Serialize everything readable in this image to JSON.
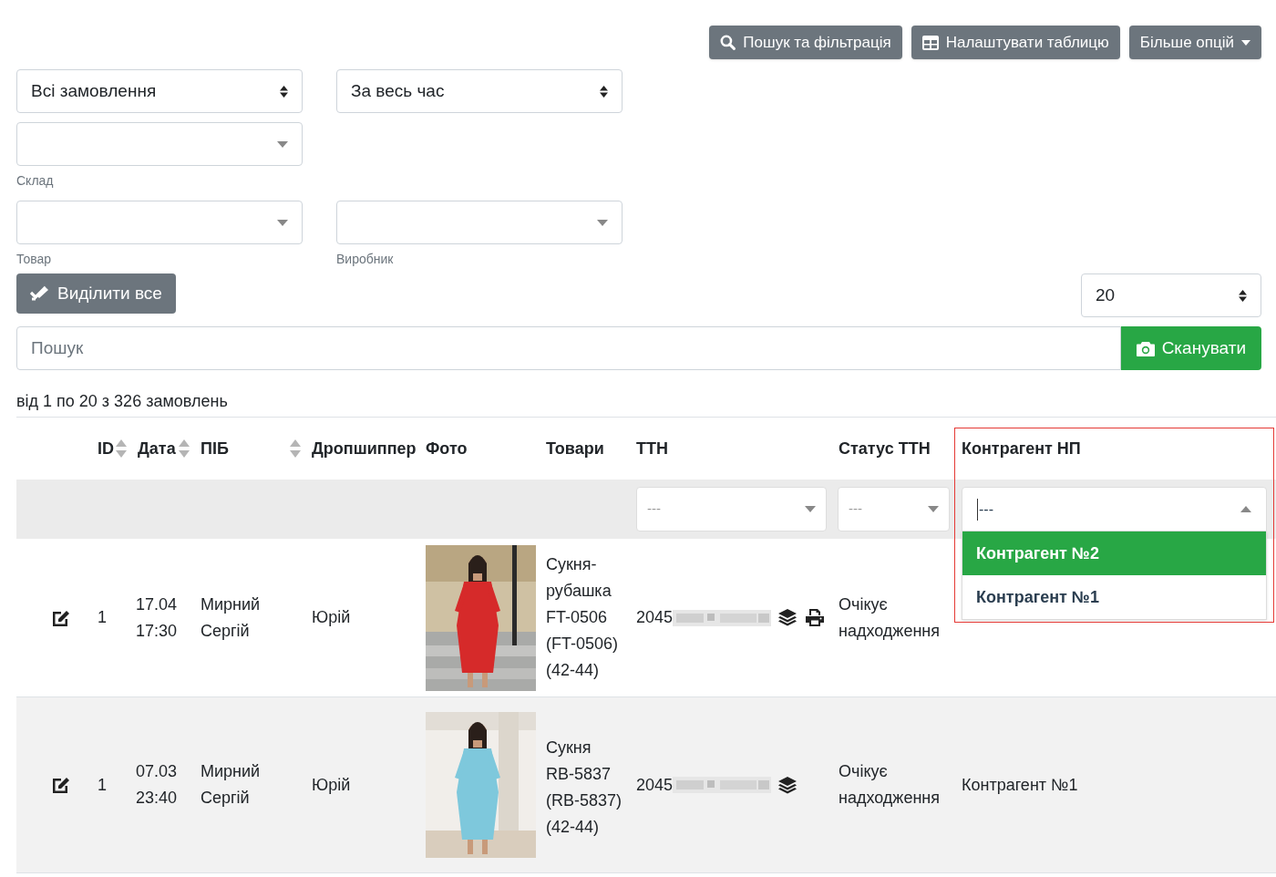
{
  "toolbar_buttons": [
    {
      "kind": "search",
      "label": "Пошук та фільтрація"
    },
    {
      "kind": "table",
      "label": "Налаштувати таблицю"
    },
    {
      "kind": "dropdown",
      "label": "Більше опцій"
    }
  ],
  "filters": [
    {
      "kind": "native",
      "value": "Всі замовлення"
    },
    {
      "kind": "native",
      "value": "За весь час"
    },
    {
      "kind": "select2",
      "label": "Склад"
    },
    {
      "kind": "select2",
      "label": "Товар"
    },
    {
      "kind": "select2",
      "label": "Виробник"
    }
  ],
  "select_all_button": {
    "label": "Виділити все"
  },
  "page_length": {
    "value": "20"
  },
  "search": {
    "placeholder": "Пошук"
  },
  "scan_button": {
    "label": "Сканувати"
  },
  "summary": "від 1 по 20 з 326 замовлень",
  "table": {
    "columns": [
      {
        "label": "ID",
        "sortable": true
      },
      {
        "label": "Дата",
        "sortable": true
      },
      {
        "label": "ПІБ",
        "sortable": true
      },
      {
        "label": "Дропшиппер",
        "sortable": false
      },
      {
        "label": "Фото",
        "sortable": false
      },
      {
        "label": "Товари",
        "sortable": false
      },
      {
        "label": "ТТН",
        "sortable": false
      },
      {
        "label": "Статус ТТН",
        "sortable": false
      },
      {
        "label": "Контрагент НП",
        "sortable": false
      }
    ],
    "filter_row": {
      "ttn": {
        "placeholder": "---"
      },
      "status": {
        "placeholder": "---"
      },
      "contractor": {
        "value": "---",
        "expanded": true,
        "options": [
          {
            "label": "Контрагент №2",
            "selected": true
          },
          {
            "label": "Контрагент №1",
            "selected": false
          }
        ]
      }
    },
    "rows": [
      {
        "id": "1",
        "date": "17.04",
        "time": "17:30",
        "name": "Мирний Сергій",
        "dropshipper": "Юрій",
        "photo": {
          "kind": "picture"
        },
        "product_lines": [
          "Сукня-",
          "рубашка",
          "FT-0506",
          "(FT-0506)",
          "(42-44)"
        ],
        "ttn": "2045",
        "printable": true,
        "status": "Очікує надходження"
      },
      {
        "id": "1",
        "date": "07.03",
        "time": "23:40",
        "name": "Мирний Сергій",
        "dropshipper": "Юрій",
        "photo": {
          "kind": "picture"
        },
        "product_lines": [
          "Сукня",
          "RB-5837",
          "(RB-5837)",
          "(42-44)"
        ],
        "ttn": "2045",
        "printable": false,
        "status": "Очікує надходження",
        "contractor": "Контрагент №1"
      }
    ]
  }
}
